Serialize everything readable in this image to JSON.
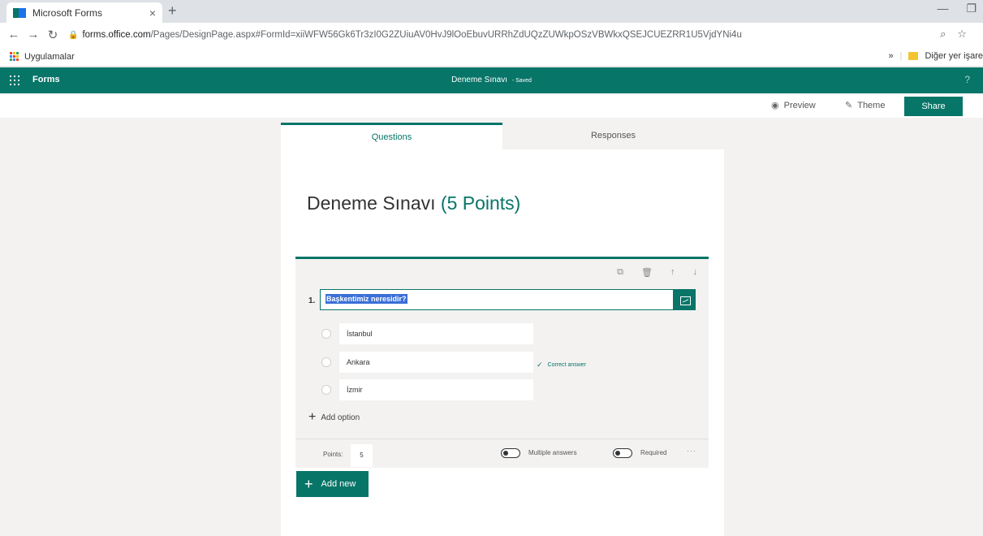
{
  "browser": {
    "tab_title": "Microsoft Forms",
    "tab_close": "×",
    "new_tab": "+",
    "url_domain": "forms.office.com",
    "url_path": "/Pages/DesignPage.aspx#FormId=xiiWFW56Gk6Tr3zI0G2ZUiuAV0HvJ9lOoEbuvURRhZdUQzZUWkpOSzVBWkxQSEJCUEZRR1U5VjdYNi4u",
    "apps_label": "Uygulamalar",
    "bookmarks_overflow": "»",
    "other_bookmarks": "Diğer yer işare",
    "icons": {
      "back": "arrow-left-icon",
      "forward": "arrow-right-icon",
      "reload": "reload-icon",
      "lock": "lock-icon",
      "zoom": "zoom-icon",
      "star": "star-icon"
    }
  },
  "header": {
    "app_name": "Forms",
    "doc_title": "Deneme Sınavı",
    "saved_status": "- Saved",
    "help": "?",
    "accent_color": "#077568"
  },
  "toolbar": {
    "preview": "Preview",
    "theme": "Theme",
    "share": "Share"
  },
  "tabs": {
    "questions": "Questions",
    "responses": "Responses"
  },
  "form": {
    "title": "Deneme Sınavı",
    "points_text": "(5 Points)"
  },
  "question": {
    "number": "1.",
    "text": "Başkentimiz neresidir?",
    "options": [
      {
        "label": "İstanbul",
        "correct": false
      },
      {
        "label": "Ankara",
        "correct": true
      },
      {
        "label": "İzmir",
        "correct": false
      }
    ],
    "correct_label": "Correct answer",
    "add_option": "Add option",
    "points_label": "Points:",
    "points_value": "5",
    "multiple_answers": "Multiple answers",
    "required": "Required",
    "more": "···"
  },
  "add_new": "Add new"
}
